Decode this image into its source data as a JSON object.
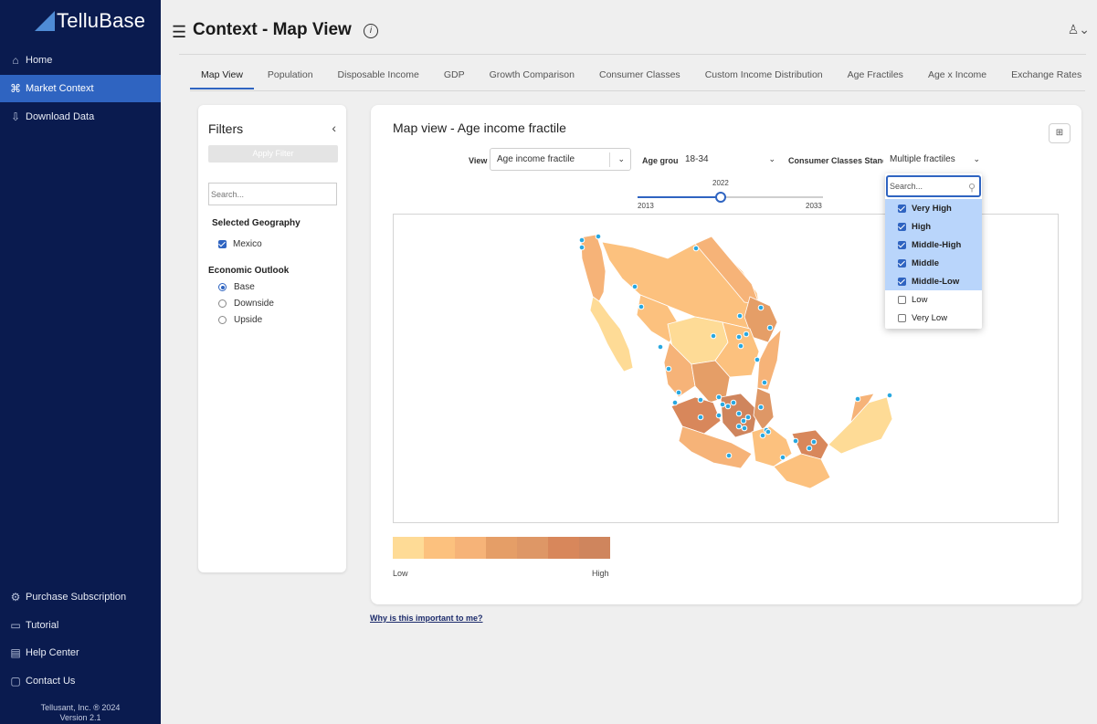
{
  "app": {
    "name": "TelluBase"
  },
  "sidebar": {
    "items": [
      {
        "label": "Home",
        "icon": "home-icon"
      },
      {
        "label": "Market Context",
        "icon": "command-icon",
        "active": true
      },
      {
        "label": "Download Data",
        "icon": "download-icon"
      }
    ],
    "bottom_items": [
      {
        "label": "Purchase Subscription",
        "icon": "gear-icon"
      },
      {
        "label": "Tutorial",
        "icon": "video-icon"
      },
      {
        "label": "Help Center",
        "icon": "book-icon"
      },
      {
        "label": "Contact Us",
        "icon": "chat-icon"
      }
    ],
    "footer": {
      "copyright": "Tellusant, Inc. ® 2024",
      "version": "Version 2.1"
    }
  },
  "header": {
    "title": "Context - Map View"
  },
  "tabs": [
    {
      "label": "Map View",
      "active": true
    },
    {
      "label": "Population"
    },
    {
      "label": "Disposable Income"
    },
    {
      "label": "GDP"
    },
    {
      "label": "Growth Comparison"
    },
    {
      "label": "Consumer Classes"
    },
    {
      "label": "Custom Income Distribution"
    },
    {
      "label": "Age Fractiles"
    },
    {
      "label": "Age x Income"
    },
    {
      "label": "Exchange Rates"
    }
  ],
  "filters": {
    "title": "Filters",
    "apply_label": "Apply Filter",
    "search_placeholder": "Search...",
    "geography_label": "Selected Geography",
    "geography": "Mexico",
    "outlook_label": "Economic Outlook",
    "outlook_options": [
      "Base",
      "Downside",
      "Upside"
    ],
    "outlook_selected": "Base"
  },
  "main": {
    "card_title": "Map view - Age income fractile",
    "view_label": "View",
    "view_value": "Age income fractile",
    "age_group_label": "Age group",
    "age_group_value": "18-34",
    "standard_label": "Consumer Classes Standard",
    "standard_value": "Multiple fractiles",
    "slider": {
      "min": "2013",
      "max": "2033",
      "value": "2022",
      "fraction": 0.45
    },
    "legend": {
      "low": "Low",
      "high": "High",
      "colors": [
        "#fedb96",
        "#fcc17e",
        "#f6b378",
        "#e59e67",
        "#de9766",
        "#d8875b",
        "#cf855d"
      ]
    },
    "why_link": "Why is this important to me?"
  },
  "dropdown": {
    "search_placeholder": "Search...",
    "options": [
      {
        "label": "Very High",
        "checked": true
      },
      {
        "label": "High",
        "checked": true
      },
      {
        "label": "Middle-High",
        "checked": true
      },
      {
        "label": "Middle",
        "checked": true
      },
      {
        "label": "Middle-Low",
        "checked": true
      },
      {
        "label": "Low",
        "checked": false
      },
      {
        "label": "Very Low",
        "checked": false
      }
    ]
  },
  "colors": {
    "sidebar": "#0a1b4f",
    "accent": "#2f64c1",
    "dot": "#29a8e0"
  }
}
